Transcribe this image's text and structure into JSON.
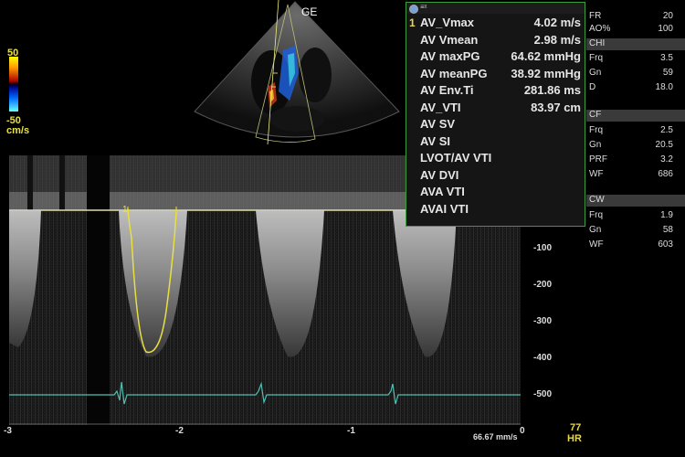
{
  "vendor_label": "GE",
  "color_scale": {
    "top": "50",
    "bottom": "-50",
    "unit": "cm/s"
  },
  "measurements": [
    {
      "idx": "1",
      "label": "AV_Vmax",
      "value": "4.02 m/s"
    },
    {
      "idx": "",
      "label": "AV Vmean",
      "value": "2.98 m/s"
    },
    {
      "idx": "",
      "label": "AV maxPG",
      "value": "64.62 mmHg"
    },
    {
      "idx": "",
      "label": "AV meanPG",
      "value": "38.92 mmHg"
    },
    {
      "idx": "",
      "label": "AV Env.Ti",
      "value": "281.86 ms"
    },
    {
      "idx": "",
      "label": "AV_VTI",
      "value": "83.97 cm"
    },
    {
      "idx": "",
      "label": "AV SV",
      "value": ""
    },
    {
      "idx": "",
      "label": "AV SI",
      "value": ""
    },
    {
      "idx": "",
      "label": "LVOT/AV VTI",
      "value": ""
    },
    {
      "idx": "",
      "label": "AV DVI",
      "value": ""
    },
    {
      "idx": "",
      "label": "AVA VTI",
      "value": ""
    },
    {
      "idx": "",
      "label": "AVAI VTI",
      "value": ""
    }
  ],
  "params": {
    "general": [
      {
        "name": "FR",
        "value": "20"
      },
      {
        "name": "AO%",
        "value": "100"
      }
    ],
    "chi": {
      "title": "CHI",
      "rows": [
        {
          "name": "Frq",
          "value": "3.5"
        },
        {
          "name": "Gn",
          "value": "59"
        },
        {
          "name": "D",
          "value": "18.0"
        }
      ]
    },
    "cf": {
      "title": "CF",
      "rows": [
        {
          "name": "Frq",
          "value": "2.5"
        },
        {
          "name": "Gn",
          "value": "20.5"
        },
        {
          "name": "PRF",
          "value": "3.2"
        },
        {
          "name": "WF",
          "value": "686"
        }
      ]
    },
    "cw": {
      "title": "CW",
      "rows": [
        {
          "name": "Frq",
          "value": "1.9"
        },
        {
          "name": "Gn",
          "value": "58"
        },
        {
          "name": "WF",
          "value": "603"
        }
      ]
    }
  },
  "velocity_axis": [
    "-100",
    "-200",
    "-300",
    "-400",
    "-500"
  ],
  "time_axis": [
    "-3",
    "-2",
    "-1",
    "0"
  ],
  "sweep_speed": "66.67 mm/s",
  "heart_rate": {
    "value": "77",
    "label": "HR"
  },
  "colors": {
    "trace": "#e8e040",
    "ecg": "#4fc0b0",
    "box_border": "#3c9d3c",
    "accent": "#e6d84a"
  }
}
